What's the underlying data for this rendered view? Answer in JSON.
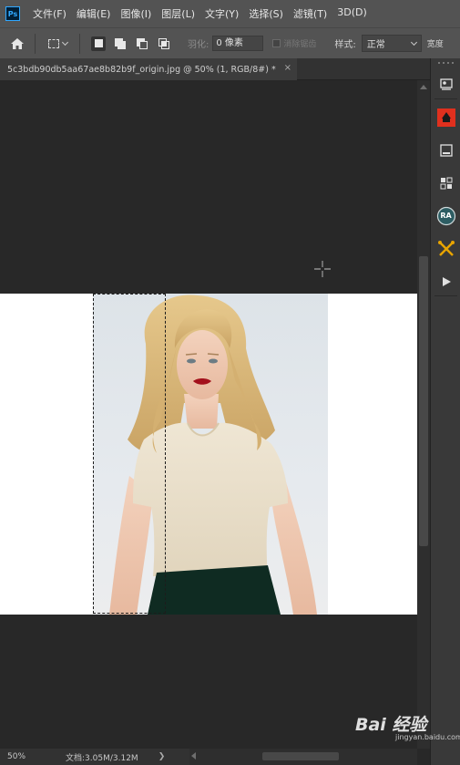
{
  "app": {
    "logo": "Ps"
  },
  "menu": [
    "文件(F)",
    "编辑(E)",
    "图像(I)",
    "图层(L)",
    "文字(Y)",
    "选择(S)",
    "滤镜(T)",
    "3D(D)"
  ],
  "options": {
    "feather_label": "羽化:",
    "feather_value": "0 像素",
    "antialias_label": "消除锯齿",
    "style_label": "样式:",
    "style_value": "正常",
    "width_label": "宽度"
  },
  "document": {
    "tab_title": "5c3bdb90db5aa67ae8b82b9f_origin.jpg @ 50% (1, RGB/8#) *",
    "close_glyph": "×"
  },
  "status": {
    "zoom": "50%",
    "doc_info": "文档:3.05M/3.12M",
    "arrow": "❯"
  },
  "watermark": {
    "brand": "Bai 经验",
    "sub": "jingyan.baidu.com"
  },
  "right_panel": {
    "icons": [
      "info-panel-icon",
      "color-swatch-icon",
      "properties-icon",
      "adjustments-icon",
      "ra-plugin-icon",
      "tools-plugin-icon",
      "play-actions-icon"
    ],
    "ra_text": "RA"
  },
  "colors": {
    "chrome": "#535353",
    "canvas_bg": "#282828",
    "panel": "#393939",
    "accent_red": "#e0301e"
  }
}
